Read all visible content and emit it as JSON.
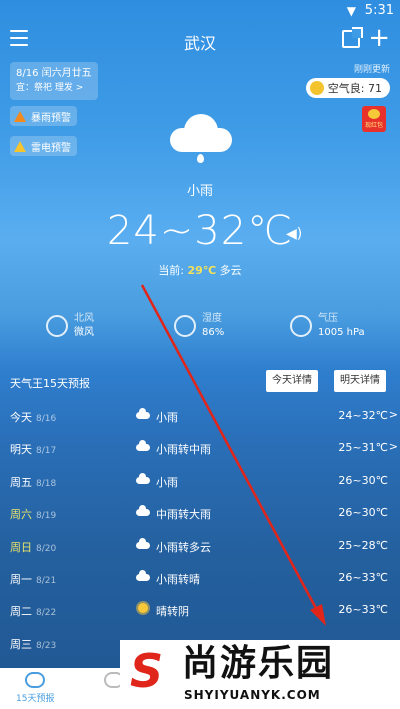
{
  "status": {
    "time": "5:31",
    "wifi_icon": "wifi-icon"
  },
  "header": {
    "city": "武汉"
  },
  "date": {
    "line1": "8/16 闰六月廿五",
    "line2": "宜：祭祀 理发 >"
  },
  "update_text": "刚刚更新",
  "aqi": {
    "label": "空气良: 71"
  },
  "redpack": {
    "label": "现红包"
  },
  "warnings": [
    "暴雨预警",
    "雷电预警"
  ],
  "current": {
    "condition": "小雨",
    "temp_range": "24~32℃",
    "now_label": "当前:",
    "now_temp": "29℃",
    "now_cond": "多云"
  },
  "metrics": [
    {
      "label": "北风",
      "value": "微风",
      "icon": "wind-icon"
    },
    {
      "label": "湿度",
      "value": "86%",
      "icon": "humidity-icon"
    },
    {
      "label": "气压",
      "value": "1005 hPa",
      "icon": "pressure-icon"
    }
  ],
  "forecast": {
    "title": "天气王15天预报",
    "today_btn": "今天详情",
    "tomorrow_btn": "明天详情",
    "rows": [
      {
        "day": "今天",
        "date": "8/16",
        "icon": "cloud-rain-icon",
        "desc": "小雨",
        "range": "24~32℃",
        "weekend": false,
        "arrow": ">"
      },
      {
        "day": "明天",
        "date": "8/17",
        "icon": "cloud-rain-icon",
        "desc": "小雨转中雨",
        "range": "25~31℃",
        "weekend": false,
        "arrow": ">"
      },
      {
        "day": "周五",
        "date": "8/18",
        "icon": "cloud-rain-icon",
        "desc": "小雨",
        "range": "26~30℃",
        "weekend": false,
        "arrow": ""
      },
      {
        "day": "周六",
        "date": "8/19",
        "icon": "cloud-rain-icon",
        "desc": "中雨转大雨",
        "range": "26~30℃",
        "weekend": true,
        "arrow": ""
      },
      {
        "day": "周日",
        "date": "8/20",
        "icon": "cloud-rain-icon",
        "desc": "小雨转多云",
        "range": "25~28℃",
        "weekend": true,
        "arrow": ""
      },
      {
        "day": "周一",
        "date": "8/21",
        "icon": "cloud-rain-icon",
        "desc": "小雨转晴",
        "range": "26~33℃",
        "weekend": false,
        "arrow": ""
      },
      {
        "day": "周二",
        "date": "8/22",
        "icon": "sun-icon",
        "desc": "晴转阴",
        "range": "26~33℃",
        "weekend": false,
        "arrow": ""
      },
      {
        "day": "周三",
        "date": "8/23",
        "icon": "",
        "desc": "",
        "range": "",
        "weekend": false,
        "arrow": ""
      }
    ]
  },
  "nav": {
    "tab1": "15天预报"
  },
  "watermark": {
    "big": "尚游乐园",
    "url": "SHYIYUANYK.COM"
  },
  "colors": {
    "accent": "#4a9ee0",
    "warn_orange": "#f28a1e",
    "warn_yellow": "#f3c42e",
    "arrow_red": "#e0251b"
  }
}
